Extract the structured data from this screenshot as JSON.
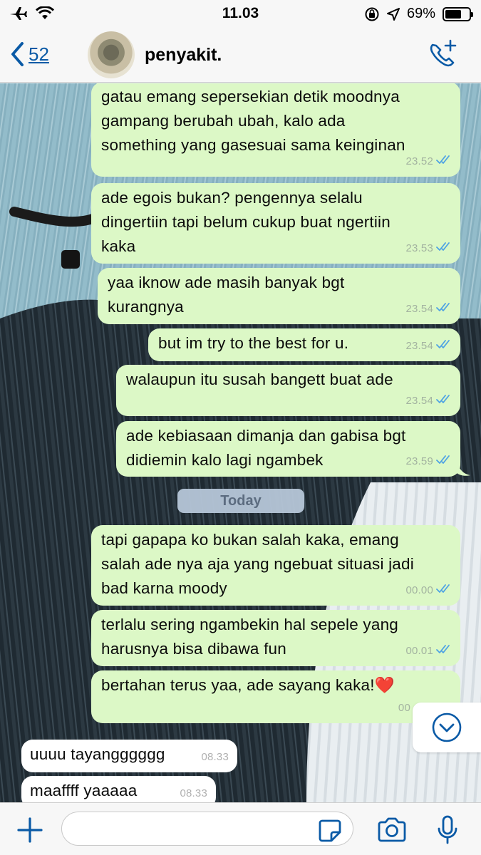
{
  "status_bar": {
    "time": "11.03",
    "battery_percent": "69%",
    "battery_level": 0.69,
    "icons": [
      "airplane-icon",
      "wifi-icon",
      "orientation-lock-icon",
      "location-icon",
      "battery-icon"
    ]
  },
  "header": {
    "back_count": "52",
    "contact_name": "penyakit.",
    "icons": [
      "back-chevron-icon",
      "add-call-icon"
    ]
  },
  "messages": [
    {
      "dir": "out",
      "text": "gatau emang sepersekian detik moodnya\ngampang berubah ubah, kalo ada\nsomething yang gasesuai sama keinginan",
      "time": "23.52"
    },
    {
      "dir": "out",
      "text": "ade egois bukan? pengennya selalu\ndingertiin tapi belum cukup buat ngertiin\nkaka",
      "time": "23.53"
    },
    {
      "dir": "out",
      "text": "yaa iknow ade masih banyak bgt\nkurangnya",
      "time": "23.54"
    },
    {
      "dir": "out",
      "text": "but im try to the best for u.",
      "time": "23.54"
    },
    {
      "dir": "out",
      "text": "walaupun itu susah bangett buat ade",
      "time": "23.54"
    },
    {
      "dir": "out",
      "text": "ade kebiasaan dimanja dan gabisa bgt\ndidiemin kalo lagi ngambek",
      "time": "23.59"
    },
    {
      "dir": "out",
      "text": "tapi gapapa ko bukan salah kaka, emang\nsalah ade nya aja yang ngebuat situasi jadi\nbad karna moody",
      "time": "00.00"
    },
    {
      "dir": "out",
      "text": "terlalu sering ngambekin hal sepele yang\nharusnya bisa dibawa fun",
      "time": "00.01"
    },
    {
      "dir": "out",
      "text": "bertahan terus yaa, ade sayang kaka!❤️",
      "time": "00"
    },
    {
      "dir": "in",
      "text": "uuuu tayangggggg",
      "time": "08.33"
    },
    {
      "dir": "in",
      "text": "maaffff yaaaaa",
      "time": "08.33"
    }
  ],
  "day_separator": "Today",
  "input": {
    "placeholder": "",
    "icons": [
      "plus-icon",
      "sticker-icon",
      "camera-icon",
      "microphone-icon"
    ]
  },
  "colors": {
    "outgoing_bubble": "#dcf8c6",
    "incoming_bubble": "#ffffff",
    "accent": "#0a5aa6",
    "read_ticks": "#4fa3e3"
  }
}
